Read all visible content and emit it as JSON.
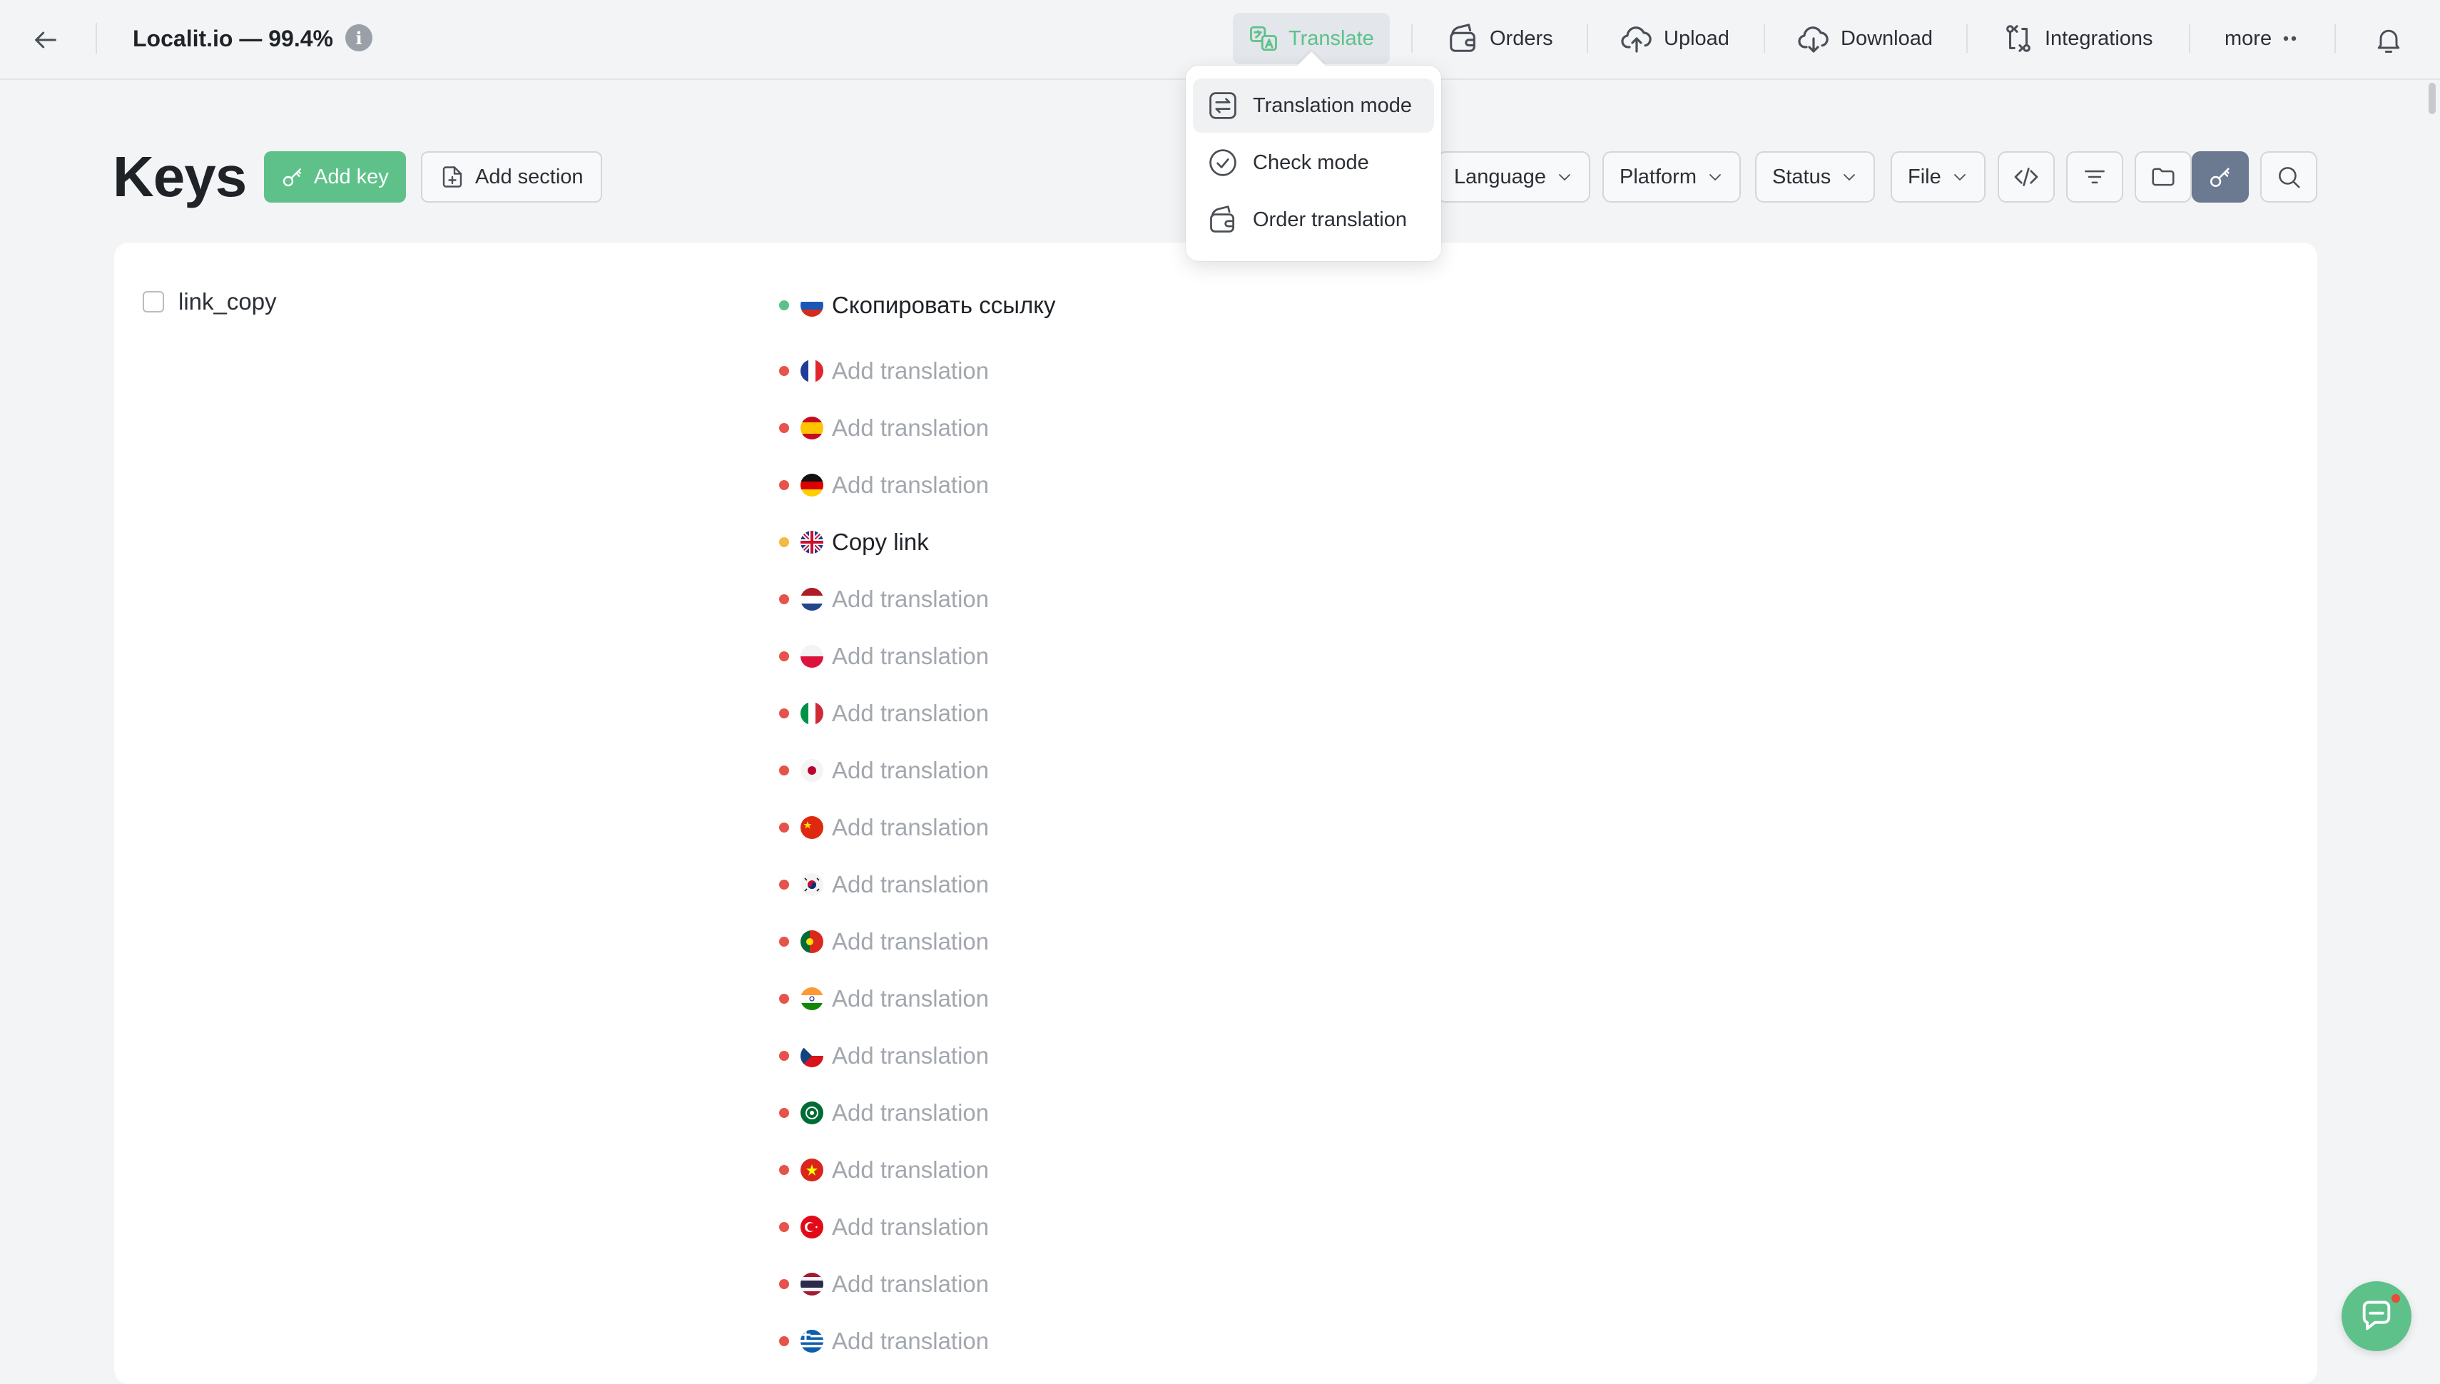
{
  "header": {
    "project_title": "Localit.io — 99.4%",
    "info_symbol": "i",
    "nav": [
      {
        "label": "Translate",
        "icon": "translate-icon",
        "active": true
      },
      {
        "label": "Orders",
        "icon": "wallet-icon"
      },
      {
        "label": "Upload",
        "icon": "cloud-upload-icon"
      },
      {
        "label": "Download",
        "icon": "cloud-download-icon"
      },
      {
        "label": "Integrations",
        "icon": "integrations-icon"
      },
      {
        "label": "more",
        "icon": "more-dots-icon"
      }
    ]
  },
  "translate_menu": {
    "items": [
      {
        "label": "Translation mode",
        "icon": "swap-icon"
      },
      {
        "label": "Check mode",
        "icon": "check-circle-icon"
      },
      {
        "label": "Order translation",
        "icon": "wallet-icon"
      }
    ]
  },
  "toolbar": {
    "title": "Keys",
    "add_key": "Add key",
    "add_section": "Add section",
    "filters": [
      "Language",
      "Platform",
      "Status",
      "File"
    ],
    "icon_buttons": [
      "code-icon",
      "filter-icon",
      "folder-icon",
      "key-icon",
      "search-icon"
    ]
  },
  "key": {
    "name": "link_copy",
    "translations": [
      {
        "lang": "ru",
        "text": "Скопировать ссылку",
        "status": "done"
      },
      {
        "lang": "fr",
        "text": "Add translation",
        "status": "missing"
      },
      {
        "lang": "es",
        "text": "Add translation",
        "status": "missing"
      },
      {
        "lang": "de",
        "text": "Add translation",
        "status": "missing"
      },
      {
        "lang": "gb",
        "text": "Copy link",
        "status": "review"
      },
      {
        "lang": "nl",
        "text": "Add translation",
        "status": "missing"
      },
      {
        "lang": "pl",
        "text": "Add translation",
        "status": "missing"
      },
      {
        "lang": "it",
        "text": "Add translation",
        "status": "missing"
      },
      {
        "lang": "jp",
        "text": "Add translation",
        "status": "missing"
      },
      {
        "lang": "cn",
        "text": "Add translation",
        "status": "missing"
      },
      {
        "lang": "kr",
        "text": "Add translation",
        "status": "missing"
      },
      {
        "lang": "pt",
        "text": "Add translation",
        "status": "missing"
      },
      {
        "lang": "in",
        "text": "Add translation",
        "status": "missing"
      },
      {
        "lang": "cz",
        "text": "Add translation",
        "status": "missing"
      },
      {
        "lang": "sa",
        "text": "Add translation",
        "status": "missing"
      },
      {
        "lang": "vn",
        "text": "Add translation",
        "status": "missing"
      },
      {
        "lang": "tr",
        "text": "Add translation",
        "status": "missing"
      },
      {
        "lang": "th",
        "text": "Add translation",
        "status": "missing"
      },
      {
        "lang": "gr",
        "text": "Add translation",
        "status": "missing"
      }
    ]
  },
  "colors": {
    "accent_green": "#5ec18a",
    "status_done": "#5ec18a",
    "status_review": "#f5b942",
    "status_missing": "#e5534b"
  }
}
